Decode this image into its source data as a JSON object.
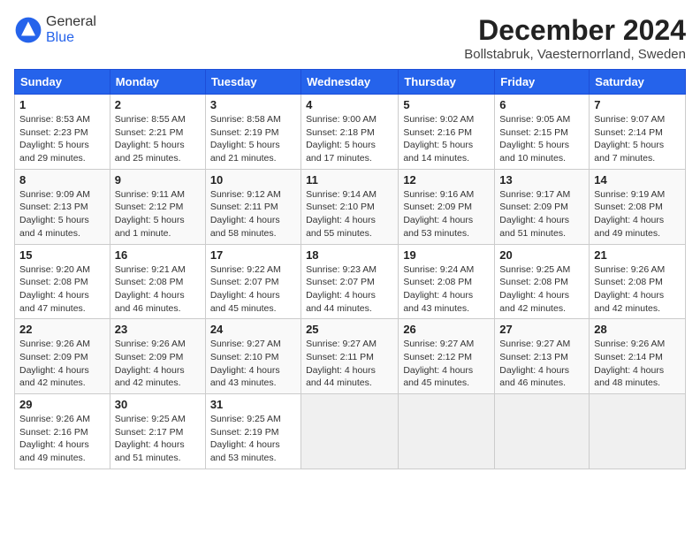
{
  "header": {
    "logo_general": "General",
    "logo_blue": "Blue",
    "month_title": "December 2024",
    "location": "Bollstabruk, Vaesternorrland, Sweden"
  },
  "columns": [
    "Sunday",
    "Monday",
    "Tuesday",
    "Wednesday",
    "Thursday",
    "Friday",
    "Saturday"
  ],
  "weeks": [
    [
      {
        "day": "1",
        "info": "Sunrise: 8:53 AM\nSunset: 2:23 PM\nDaylight: 5 hours\nand 29 minutes."
      },
      {
        "day": "2",
        "info": "Sunrise: 8:55 AM\nSunset: 2:21 PM\nDaylight: 5 hours\nand 25 minutes."
      },
      {
        "day": "3",
        "info": "Sunrise: 8:58 AM\nSunset: 2:19 PM\nDaylight: 5 hours\nand 21 minutes."
      },
      {
        "day": "4",
        "info": "Sunrise: 9:00 AM\nSunset: 2:18 PM\nDaylight: 5 hours\nand 17 minutes."
      },
      {
        "day": "5",
        "info": "Sunrise: 9:02 AM\nSunset: 2:16 PM\nDaylight: 5 hours\nand 14 minutes."
      },
      {
        "day": "6",
        "info": "Sunrise: 9:05 AM\nSunset: 2:15 PM\nDaylight: 5 hours\nand 10 minutes."
      },
      {
        "day": "7",
        "info": "Sunrise: 9:07 AM\nSunset: 2:14 PM\nDaylight: 5 hours\nand 7 minutes."
      }
    ],
    [
      {
        "day": "8",
        "info": "Sunrise: 9:09 AM\nSunset: 2:13 PM\nDaylight: 5 hours\nand 4 minutes."
      },
      {
        "day": "9",
        "info": "Sunrise: 9:11 AM\nSunset: 2:12 PM\nDaylight: 5 hours\nand 1 minute."
      },
      {
        "day": "10",
        "info": "Sunrise: 9:12 AM\nSunset: 2:11 PM\nDaylight: 4 hours\nand 58 minutes."
      },
      {
        "day": "11",
        "info": "Sunrise: 9:14 AM\nSunset: 2:10 PM\nDaylight: 4 hours\nand 55 minutes."
      },
      {
        "day": "12",
        "info": "Sunrise: 9:16 AM\nSunset: 2:09 PM\nDaylight: 4 hours\nand 53 minutes."
      },
      {
        "day": "13",
        "info": "Sunrise: 9:17 AM\nSunset: 2:09 PM\nDaylight: 4 hours\nand 51 minutes."
      },
      {
        "day": "14",
        "info": "Sunrise: 9:19 AM\nSunset: 2:08 PM\nDaylight: 4 hours\nand 49 minutes."
      }
    ],
    [
      {
        "day": "15",
        "info": "Sunrise: 9:20 AM\nSunset: 2:08 PM\nDaylight: 4 hours\nand 47 minutes."
      },
      {
        "day": "16",
        "info": "Sunrise: 9:21 AM\nSunset: 2:08 PM\nDaylight: 4 hours\nand 46 minutes."
      },
      {
        "day": "17",
        "info": "Sunrise: 9:22 AM\nSunset: 2:07 PM\nDaylight: 4 hours\nand 45 minutes."
      },
      {
        "day": "18",
        "info": "Sunrise: 9:23 AM\nSunset: 2:07 PM\nDaylight: 4 hours\nand 44 minutes."
      },
      {
        "day": "19",
        "info": "Sunrise: 9:24 AM\nSunset: 2:08 PM\nDaylight: 4 hours\nand 43 minutes."
      },
      {
        "day": "20",
        "info": "Sunrise: 9:25 AM\nSunset: 2:08 PM\nDaylight: 4 hours\nand 42 minutes."
      },
      {
        "day": "21",
        "info": "Sunrise: 9:26 AM\nSunset: 2:08 PM\nDaylight: 4 hours\nand 42 minutes."
      }
    ],
    [
      {
        "day": "22",
        "info": "Sunrise: 9:26 AM\nSunset: 2:09 PM\nDaylight: 4 hours\nand 42 minutes."
      },
      {
        "day": "23",
        "info": "Sunrise: 9:26 AM\nSunset: 2:09 PM\nDaylight: 4 hours\nand 42 minutes."
      },
      {
        "day": "24",
        "info": "Sunrise: 9:27 AM\nSunset: 2:10 PM\nDaylight: 4 hours\nand 43 minutes."
      },
      {
        "day": "25",
        "info": "Sunrise: 9:27 AM\nSunset: 2:11 PM\nDaylight: 4 hours\nand 44 minutes."
      },
      {
        "day": "26",
        "info": "Sunrise: 9:27 AM\nSunset: 2:12 PM\nDaylight: 4 hours\nand 45 minutes."
      },
      {
        "day": "27",
        "info": "Sunrise: 9:27 AM\nSunset: 2:13 PM\nDaylight: 4 hours\nand 46 minutes."
      },
      {
        "day": "28",
        "info": "Sunrise: 9:26 AM\nSunset: 2:14 PM\nDaylight: 4 hours\nand 48 minutes."
      }
    ],
    [
      {
        "day": "29",
        "info": "Sunrise: 9:26 AM\nSunset: 2:16 PM\nDaylight: 4 hours\nand 49 minutes."
      },
      {
        "day": "30",
        "info": "Sunrise: 9:25 AM\nSunset: 2:17 PM\nDaylight: 4 hours\nand 51 minutes."
      },
      {
        "day": "31",
        "info": "Sunrise: 9:25 AM\nSunset: 2:19 PM\nDaylight: 4 hours\nand 53 minutes."
      },
      {
        "day": "",
        "info": ""
      },
      {
        "day": "",
        "info": ""
      },
      {
        "day": "",
        "info": ""
      },
      {
        "day": "",
        "info": ""
      }
    ]
  ]
}
